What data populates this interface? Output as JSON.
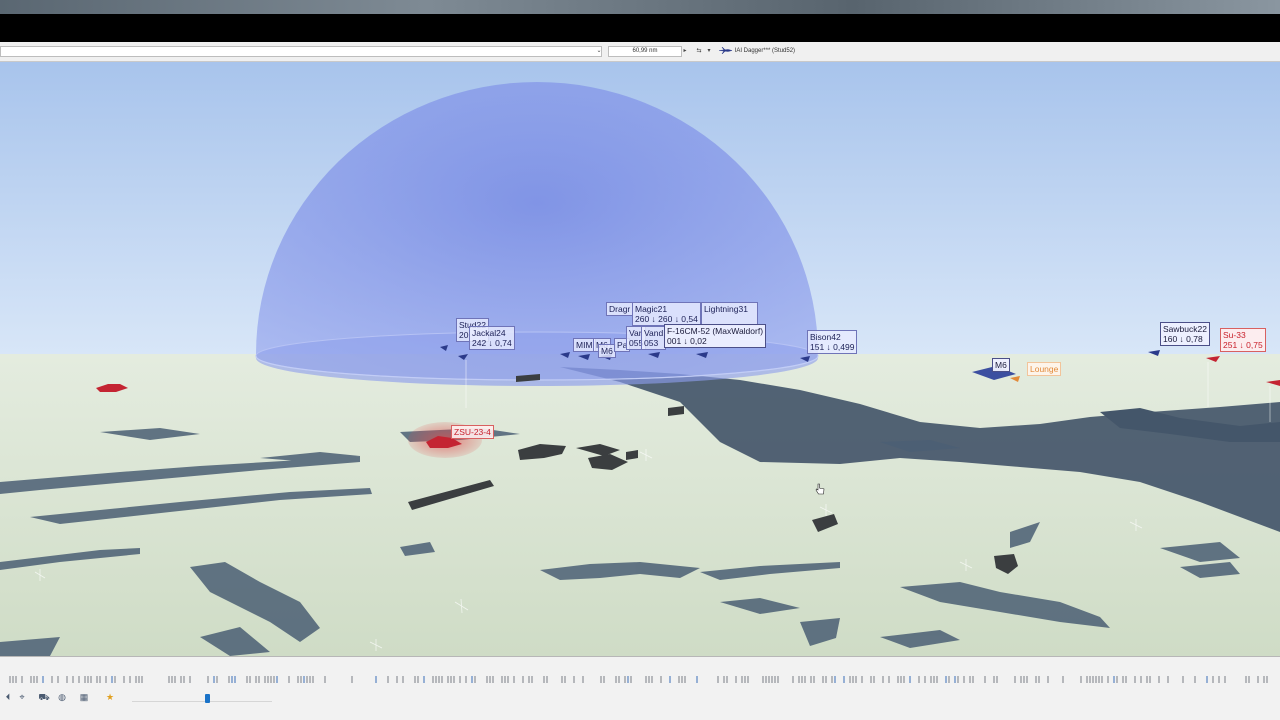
{
  "toolbar": {
    "range_value": "60,99 nm",
    "selected_unit": "IAI Dagger*** (Stud52)"
  },
  "map_labels": {
    "stud22": "Stud22\n20",
    "jackal24": "Jackal24\n242 ↓ 0,74",
    "dragon": "Dragr",
    "magic21": "Magic21\n260 ↓ 260 ↓ 0,54",
    "lightning31": "Lightning31\n   ",
    "mim": "MIM",
    "m6_a": "M6",
    "pa": "Pa",
    "m6_b": "M6",
    "var": "Var\n055",
    "vando": "Vand\n053",
    "maxwaldorf": "F-16CM-52 (MaxWaldorf)\n001 ↓ 0,02",
    "bison42": "Bison42\n151 ↓ 0,499",
    "m6_c": "M6",
    "lounge": "Lounge",
    "sawbuck22": "Sawbuck22\n160 ↓ 0,78",
    "su33": "Su-33\n251 ↓ 0,75",
    "zsu234": "ZSU-23-4"
  },
  "icons": {
    "cursor": "hand-cursor-icon",
    "aircraft": "aircraft-icon",
    "vehicle": "vehicle-icon",
    "star": "star-icon"
  },
  "colors": {
    "dome": "#7f8fe6",
    "hostile": "#c81f2a",
    "friendly_text": "#1b1f55",
    "water": "#44566a",
    "ground": "#d6e2cf",
    "sky_top": "#a8c4ec"
  },
  "timeline": {
    "slider_position_fraction": 0.52
  }
}
